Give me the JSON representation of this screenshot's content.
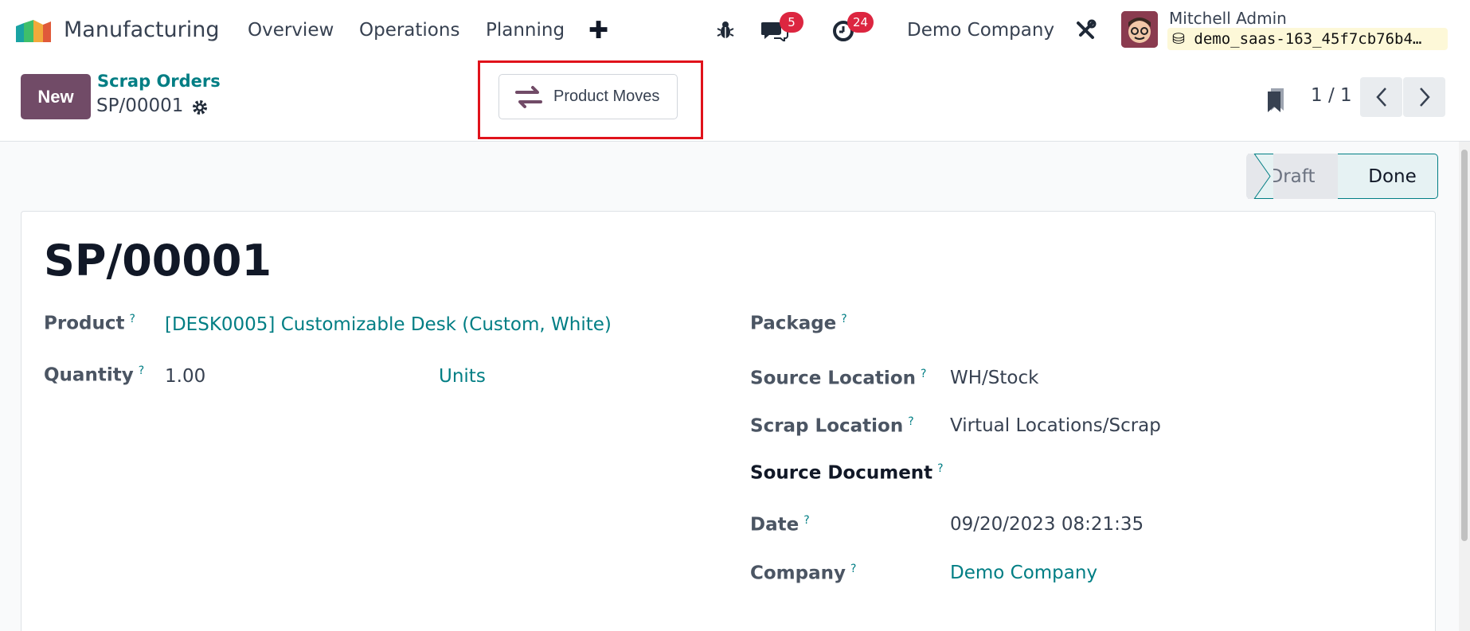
{
  "navbar": {
    "app_name": "Manufacturing",
    "menu": [
      "Overview",
      "Operations",
      "Planning"
    ],
    "plus_icon": "plus-icon",
    "bug_icon": "bug-icon",
    "chat_count": "5",
    "activity_count": "24",
    "company": "Demo Company",
    "tools_icon": "tools-icon",
    "user_name": "Mitchell Admin",
    "database": "demo_saas-163_45f7cb76b4…"
  },
  "control": {
    "new_label": "New",
    "breadcrumb": "Scrap Orders",
    "record_name": "SP/00001",
    "product_moves_label": "Product Moves",
    "pager": "1 / 1"
  },
  "status": {
    "draft": "Draft",
    "done": "Done",
    "active": "Done"
  },
  "form": {
    "title": "SP/00001",
    "product_label": "Product",
    "product_value": "[DESK0005] Customizable Desk (Custom, White)",
    "quantity_label": "Quantity",
    "quantity_value": "1.00",
    "uom_value": "Units",
    "package_label": "Package",
    "source_location_label": "Source Location",
    "source_location_value": "WH/Stock",
    "scrap_location_label": "Scrap Location",
    "scrap_location_value": "Virtual Locations/Scrap",
    "source_document_label": "Source Document",
    "date_label": "Date",
    "date_value": "09/20/2023 08:21:35",
    "company_label": "Company",
    "company_value": "Demo Company",
    "tooltip_marker": "?"
  },
  "colors": {
    "brand": "#714b67",
    "link": "#017e84",
    "badge": "#dc2640",
    "highlight": "#e0121b"
  }
}
